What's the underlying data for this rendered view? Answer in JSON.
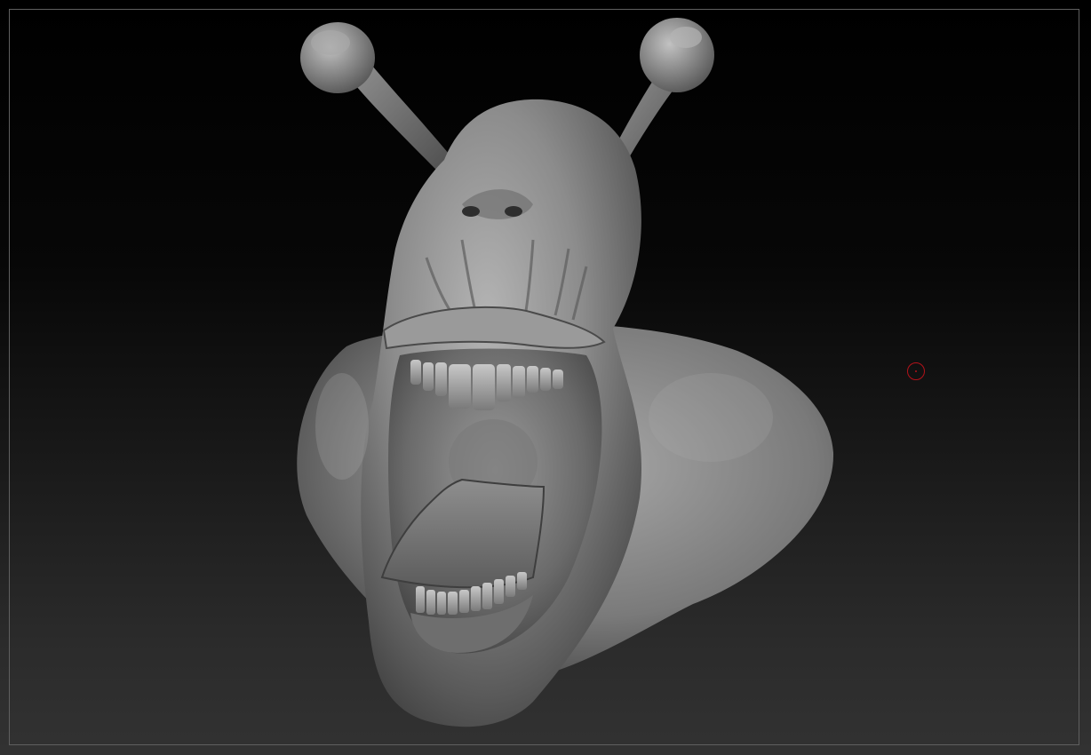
{
  "canvas": {
    "background_top": "#000000",
    "background_bottom": "#323232",
    "frame_color": "#5f5f5f"
  },
  "model": {
    "name": "",
    "material_color": "#8a8a8a"
  },
  "cursor": {
    "icon": "brush-circle-icon",
    "color": "#b3121a"
  }
}
